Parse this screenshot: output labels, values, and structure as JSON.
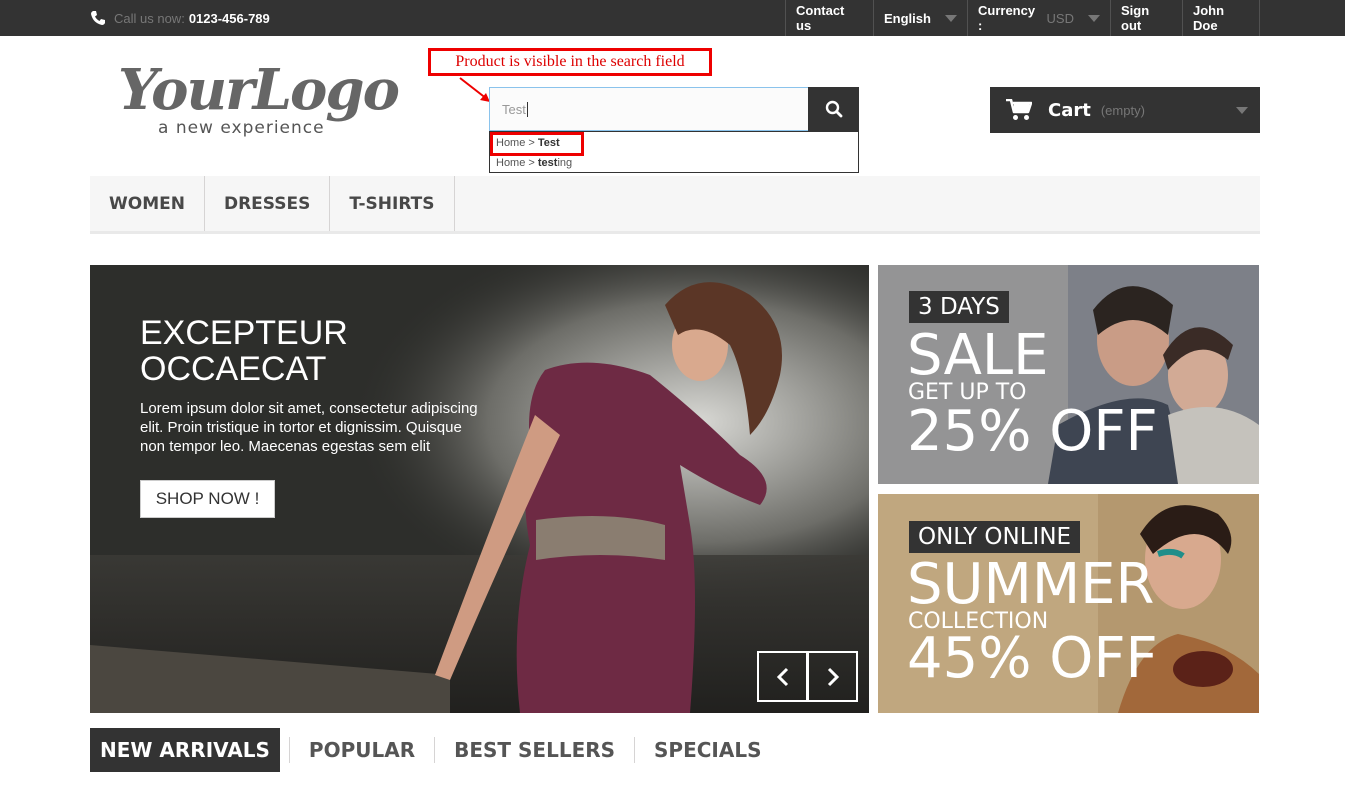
{
  "topbar": {
    "call_label": "Call us now:",
    "call_number": "0123-456-789",
    "contact": "Contact us",
    "language": "English",
    "currency_label": "Currency :",
    "currency_value": "USD",
    "signout": "Sign out",
    "user": "John Doe"
  },
  "header": {
    "logo_text": "YourLogo",
    "logo_tagline": "a new experience",
    "annotation": "Product is visible in the search field",
    "search_value": "Test",
    "suggestions": [
      {
        "prefix": "Home > ",
        "bold": "Test",
        "rest": ""
      },
      {
        "prefix": "Home > ",
        "bold": "test",
        "rest": "ing"
      }
    ],
    "cart_label": "Cart",
    "cart_status": "(empty)"
  },
  "menu": [
    "WOMEN",
    "DRESSES",
    "T-SHIRTS"
  ],
  "hero": {
    "title": "EXCEPTEUR OCCAECAT",
    "text": "Lorem ipsum dolor sit amet, consectetur adipiscing elit. Proin tristique in tortor et dignissim. Quisque non tempor leo. Maecenas egestas sem elit",
    "button": "SHOP NOW !"
  },
  "banners": [
    {
      "badge": "3 DAYS",
      "big": "SALE",
      "mid": "GET UP TO",
      "offer": "25% OFF"
    },
    {
      "badge": "ONLY ONLINE",
      "big": "SUMMER",
      "mid": "COLLECTION",
      "offer": "45% OFF"
    }
  ],
  "tabs": [
    "NEW ARRIVALS",
    "POPULAR",
    "BEST SELLERS",
    "SPECIALS"
  ],
  "colors": {
    "dark": "#333333",
    "annotation": "#e00000",
    "search_border": "#8ac3ec"
  }
}
